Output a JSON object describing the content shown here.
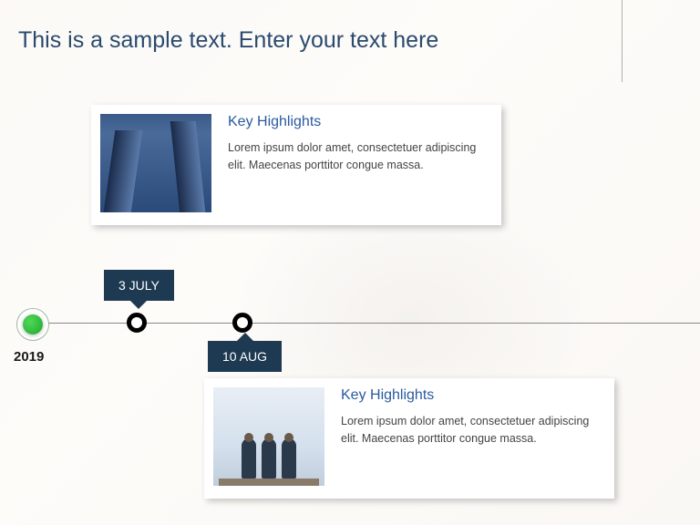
{
  "title": "This is a sample text. Enter your text here",
  "year": "2019",
  "events": [
    {
      "date": "3 JULY",
      "heading": "Key Highlights",
      "body": "Lorem ipsum dolor amet, consectetuer adipiscing elit. Maecenas porttitor congue massa."
    },
    {
      "date": "10 AUG",
      "heading": "Key Highlights",
      "body": "Lorem ipsum dolor amet, consectetuer adipiscing elit. Maecenas porttitor congue massa."
    }
  ]
}
